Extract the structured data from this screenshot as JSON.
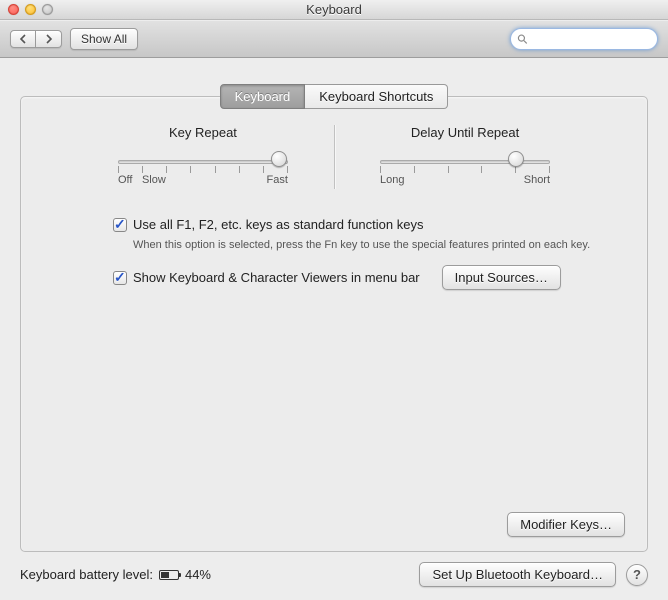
{
  "window": {
    "title": "Keyboard"
  },
  "toolbar": {
    "show_all": "Show All",
    "search_placeholder": ""
  },
  "tabs": [
    {
      "label": "Keyboard",
      "active": true
    },
    {
      "label": "Keyboard Shortcuts",
      "active": false
    }
  ],
  "sliders": {
    "key_repeat": {
      "label": "Key Repeat",
      "min_label": "Off",
      "near_min_label": "Slow",
      "max_label": "Fast",
      "ticks": 8,
      "value_pct": 95
    },
    "delay_until_repeat": {
      "label": "Delay Until Repeat",
      "min_label": "Long",
      "max_label": "Short",
      "ticks": 6,
      "value_pct": 80
    }
  },
  "options": {
    "fn_keys": {
      "label": "Use all F1, F2, etc. keys as standard function keys",
      "sub": "When this option is selected, press the Fn key to use the special features printed on each key.",
      "checked": true
    },
    "viewers": {
      "label": "Show Keyboard & Character Viewers in menu bar",
      "checked": true
    },
    "input_sources_btn": "Input Sources…",
    "modifier_keys_btn": "Modifier Keys…"
  },
  "footer": {
    "battery_label": "Keyboard battery level:",
    "battery_pct": "44%",
    "battery_fill_pct": 44,
    "bluetooth_btn": "Set Up Bluetooth Keyboard…"
  }
}
